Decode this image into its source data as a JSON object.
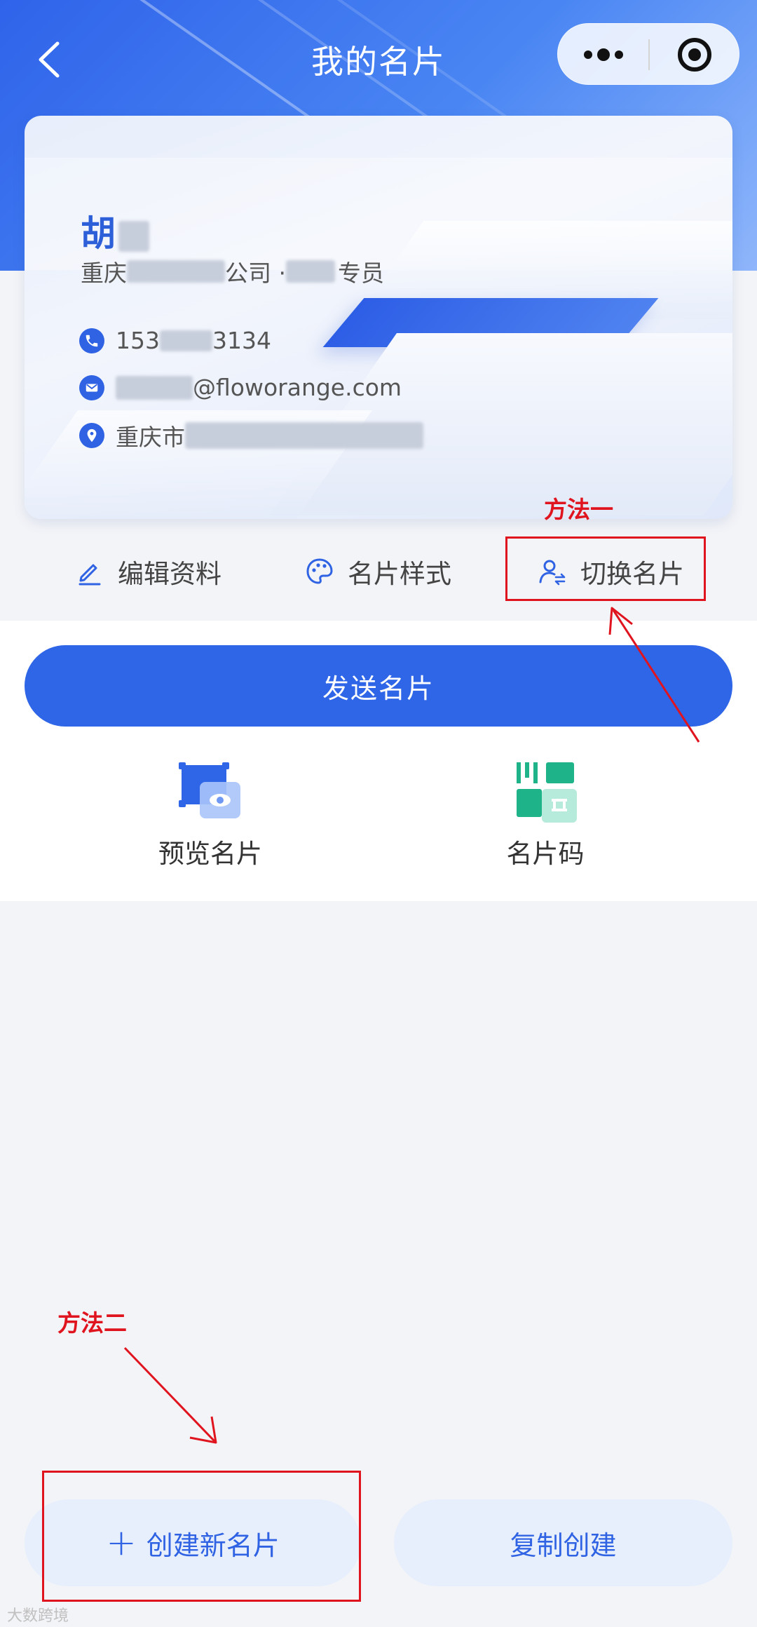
{
  "nav": {
    "title": "我的名片"
  },
  "card": {
    "name": "胡",
    "company_prefix": "重庆",
    "company_mid": "公司 · ",
    "role_suffix": "专员",
    "phone_prefix": "153",
    "phone_suffix": "3134",
    "email_suffix": "@floworange.com",
    "address_prefix": "重庆市"
  },
  "actions": {
    "edit": "编辑资料",
    "style": "名片样式",
    "switch": "切换名片"
  },
  "annotations": {
    "method_one": "方法一",
    "method_two": "方法二"
  },
  "panel": {
    "send": "发送名片",
    "preview": "预览名片",
    "code": "名片码"
  },
  "bottom": {
    "create_plus": "+",
    "create": "创建新名片",
    "copy": "复制创建"
  },
  "watermark": "大数跨境",
  "colors": {
    "primary": "#2f66e8",
    "annotation": "#e0141e",
    "code_green": "#1fb38a"
  }
}
